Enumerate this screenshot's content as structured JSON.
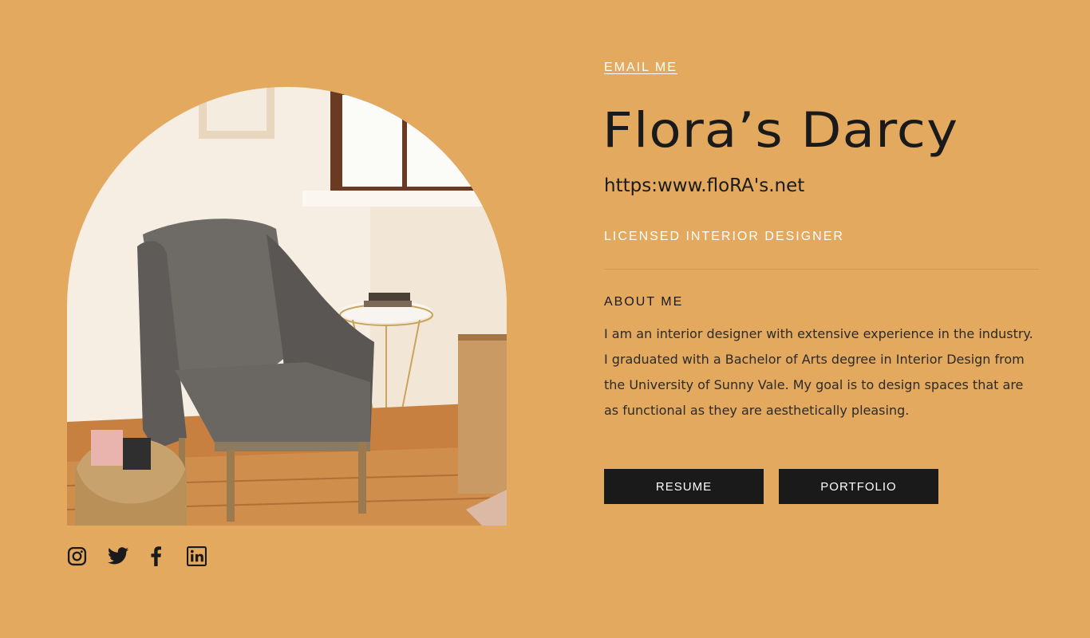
{
  "profile": {
    "email_label": "EMAIL ME",
    "name": "Flora’s Darcy",
    "website": "https:www.floRA's.net",
    "title": "LICENSED INTERIOR DESIGNER"
  },
  "about": {
    "heading": "ABOUT ME",
    "text": "I am an interior designer with extensive experience in the industry. I graduated with a Bachelor of Arts degree in Interior Design from the University of Sunny Vale. My goal is to design spaces that are as functional as they are aesthetically pleasing."
  },
  "buttons": {
    "resume": "RESUME",
    "portfolio": "PORTFOLIO"
  },
  "socials": [
    "instagram-icon",
    "twitter-icon",
    "facebook-icon",
    "linkedin-icon"
  ],
  "colors": {
    "background": "#E3A95F",
    "button": "#1A1A1A",
    "accent_text": "#FFFFFF"
  }
}
